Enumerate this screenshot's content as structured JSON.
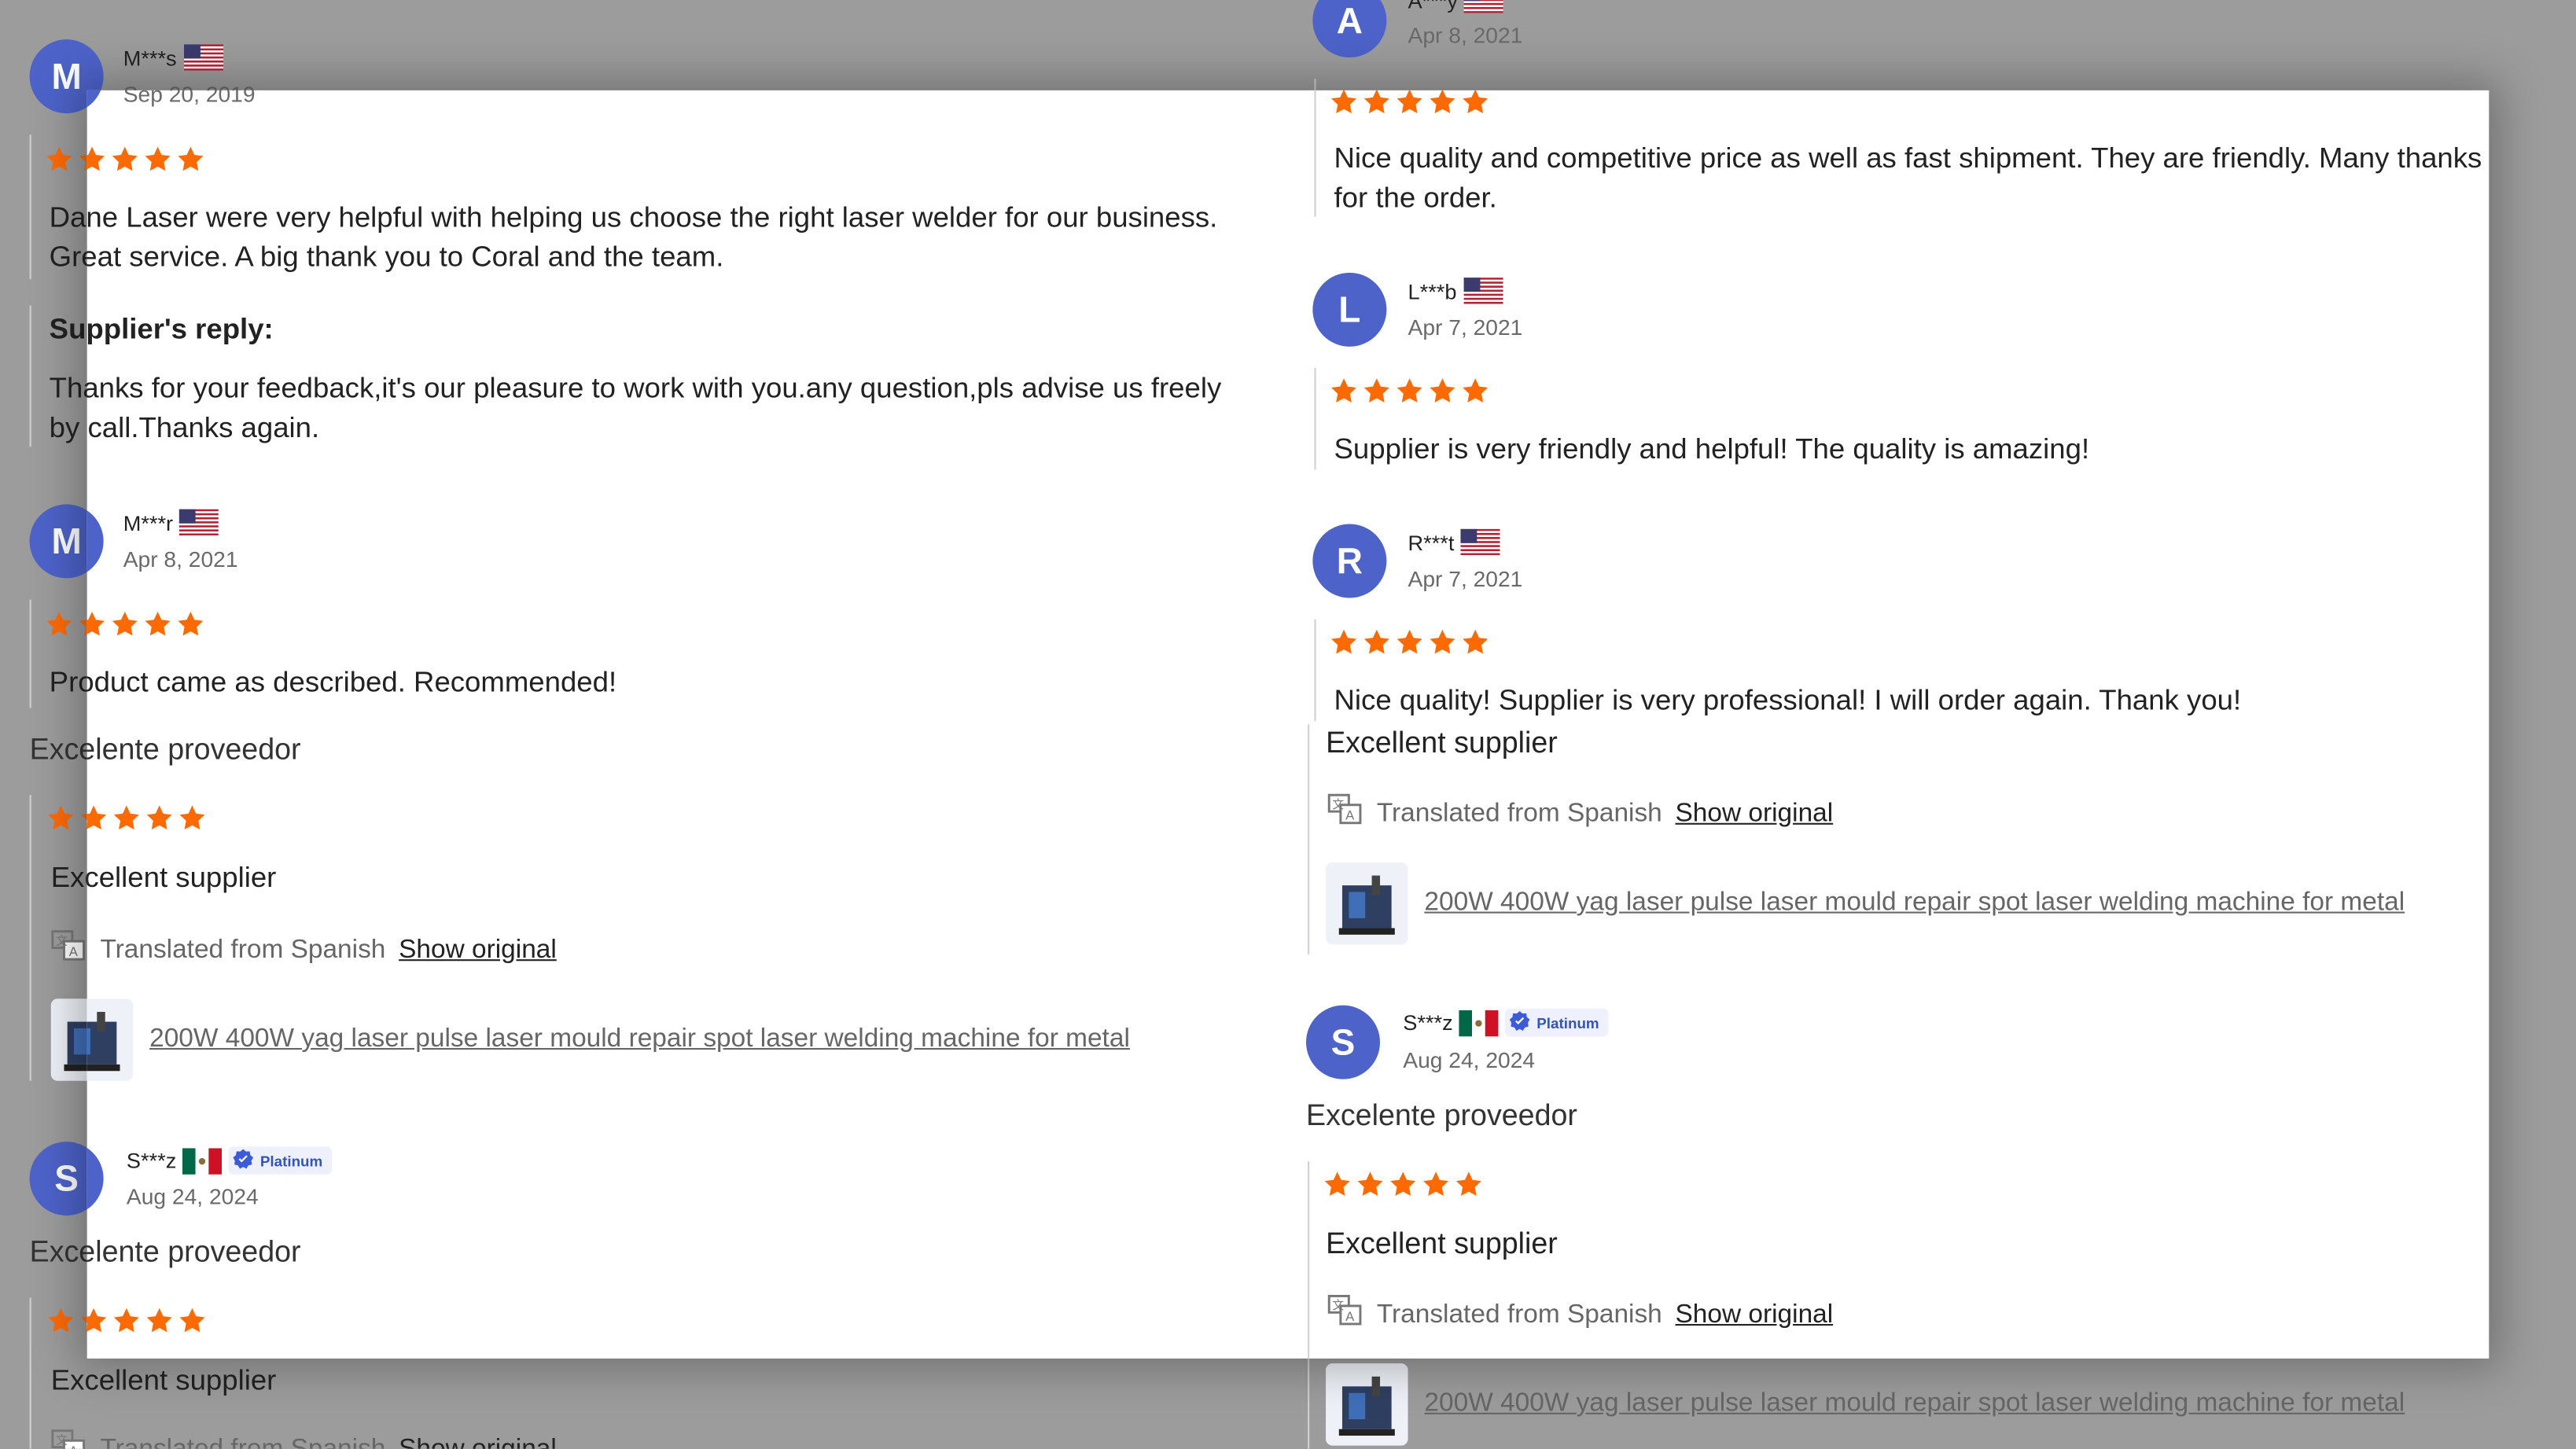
{
  "colors": {
    "avatar": "#4d63c9",
    "star": "#ff6a00",
    "overlay": "#9c9c9c",
    "link": "#666666"
  },
  "left_col": {
    "r1": {
      "initial": "M",
      "name": "M***s",
      "flag": "us-flag",
      "date": "Sep 20, 2019",
      "rating": 5,
      "text": "Dane Laser were very helpful with helping us choose the right laser welder for our business. Great service. A big thank you to Coral and the team.",
      "reply_title": "Supplier's reply:",
      "reply_text": "Thanks for your feedback,it's our pleasure to work with you.any question,pls advise us freely by call.Thanks again."
    },
    "r2": {
      "initial": "M",
      "name": "M***r",
      "flag": "us-flag",
      "date": "Apr 8, 2021",
      "rating": 5,
      "text": "Product came as described. Recommended!"
    },
    "r3": {
      "original": "Excelente proveedor",
      "rating": 5,
      "text": "Excellent supplier",
      "translated_label": "Translated from Spanish",
      "show_original": "Show original",
      "product": "200W 400W yag laser pulse laser mould repair spot laser welding machine for metal"
    },
    "r4": {
      "initial": "S",
      "name": "S***z",
      "flag": "mx-flag",
      "badge": "Platinum",
      "date": "Aug 24, 2024",
      "original": "Excelente proveedor",
      "rating": 5,
      "text": "Excellent supplier",
      "translated_label": "Translated from Spanish",
      "show_original": "Show original"
    }
  },
  "right_col": {
    "r1": {
      "initial": "A",
      "name": "A***y",
      "flag": "us-flag",
      "date": "Apr 8, 2021",
      "rating": 5,
      "text": "Nice quality and competitive price as well as fast shipment. They are friendly. Many thanks for the order."
    },
    "r2": {
      "initial": "L",
      "name": "L***b",
      "flag": "us-flag",
      "date": "Apr 7, 2021",
      "rating": 5,
      "text": "Supplier is very friendly and helpful! The quality is amazing!"
    },
    "r3": {
      "initial": "R",
      "name": "R***t",
      "flag": "us-flag",
      "date": "Apr 7, 2021",
      "rating": 5,
      "text": "Nice quality! Supplier is very professional! I will order again. Thank you!"
    },
    "r3b": {
      "text": "Excellent supplier",
      "translated_label": "Translated from Spanish",
      "show_original": "Show original",
      "product": "200W 400W yag laser pulse laser mould repair spot laser welding machine for metal"
    },
    "r4": {
      "initial": "S",
      "name": "S***z",
      "flag": "mx-flag",
      "badge": "Platinum",
      "date": "Aug 24, 2024",
      "original": "Excelente proveedor",
      "rating": 5,
      "text": "Excellent supplier",
      "translated_label": "Translated from Spanish",
      "show_original": "Show original",
      "product": "200W 400W yag laser pulse laser mould repair spot laser welding machine for metal"
    }
  }
}
